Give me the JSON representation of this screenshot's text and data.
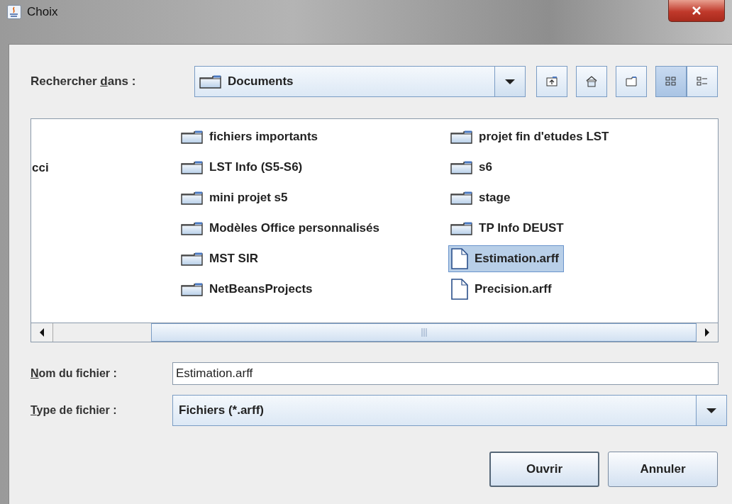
{
  "window": {
    "title": "Choix"
  },
  "look_in": {
    "label": {
      "before": "Rechercher ",
      "mnemonic": "d",
      "after": "ans :"
    },
    "value": "Documents"
  },
  "toolbar": [
    {
      "kind": "up"
    },
    {
      "kind": "home"
    },
    {
      "kind": "new_folder"
    },
    {
      "kind": "list_view",
      "selected": true
    },
    {
      "kind": "details_view",
      "selected": false
    }
  ],
  "file_columns": [
    {
      "items": [
        {
          "name": "cci",
          "kind": "cut",
          "selected": false
        }
      ]
    },
    {
      "items": [
        {
          "name": "fichiers importants",
          "kind": "folder",
          "selected": false
        },
        {
          "name": "LST Info (S5-S6)",
          "kind": "folder",
          "selected": false
        },
        {
          "name": "mini projet s5",
          "kind": "folder",
          "selected": false
        },
        {
          "name": "Modèles Office personnalisés",
          "kind": "folder",
          "selected": false
        },
        {
          "name": "MST SIR",
          "kind": "folder",
          "selected": false
        },
        {
          "name": "NetBeansProjects",
          "kind": "folder",
          "selected": false
        }
      ]
    },
    {
      "items": [
        {
          "name": "projet fin d'etudes LST",
          "kind": "folder",
          "selected": false
        },
        {
          "name": "s6",
          "kind": "folder",
          "selected": false
        },
        {
          "name": "stage",
          "kind": "folder",
          "selected": false
        },
        {
          "name": "TP Info DEUST",
          "kind": "folder",
          "selected": false
        },
        {
          "name": "Estimation.arff",
          "kind": "file",
          "selected": true
        },
        {
          "name": "Precision.arff",
          "kind": "file",
          "selected": false
        }
      ]
    }
  ],
  "file_name": {
    "label": {
      "mnemonic": "N",
      "after": "om du fichier :"
    },
    "value": "Estimation.arff"
  },
  "file_type": {
    "label": {
      "mnemonic": "T",
      "after": "ype de fichier :"
    },
    "value": "Fichiers (*.arff)"
  },
  "buttons": [
    {
      "label": "Ouvrir",
      "kind": "default"
    },
    {
      "label": "Annuler",
      "kind": "normal"
    }
  ]
}
